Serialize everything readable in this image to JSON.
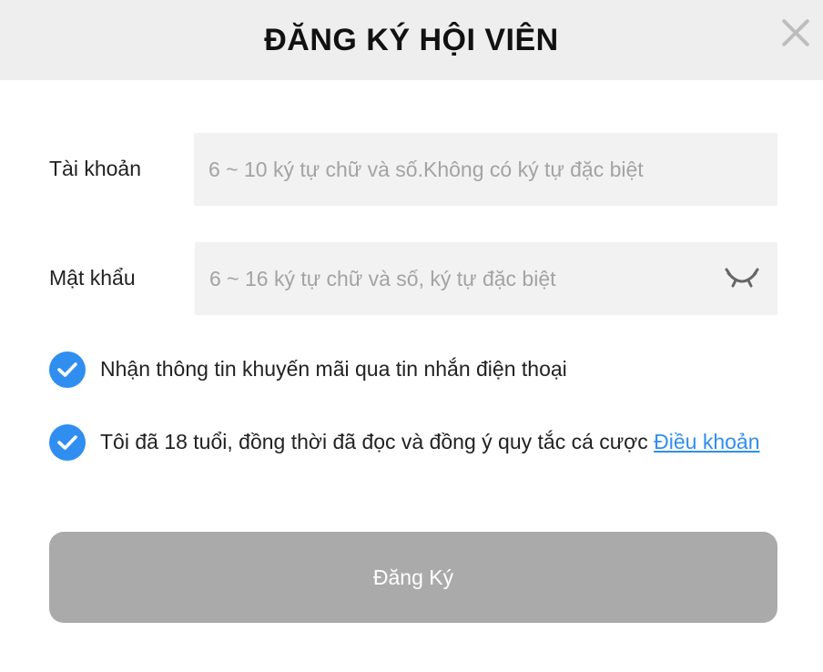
{
  "modal": {
    "title": "ĐĂNG KÝ HỘI VIÊN"
  },
  "form": {
    "account_label": "Tài khoản",
    "account_placeholder": "6 ~ 10 ký tự chữ và số.Không có ký tự đặc biệt",
    "account_value": "",
    "password_label": "Mật khẩu",
    "password_placeholder": "6 ~ 16 ký tự chữ và số, ký tự đặc biệt",
    "password_value": "",
    "promo_text": "Nhận thông tin khuyến mãi qua tin nhắn điện thoại",
    "promo_checked": true,
    "age_text": "Tôi đã 18 tuổi, đồng thời đã đọc và đồng ý quy tắc cá cược ",
    "terms_link": "Điều khoản",
    "age_checked": true,
    "submit_label": "Đăng Ký"
  },
  "icons": {
    "close": "close-icon",
    "password_toggle": "eye-closed-icon",
    "checkbox": "checkmark-icon"
  },
  "colors": {
    "accent": "#2f8ef0",
    "header_bg": "#eeeeee",
    "input_bg": "#f2f2f2",
    "submit_disabled": "#aaaaaa"
  }
}
